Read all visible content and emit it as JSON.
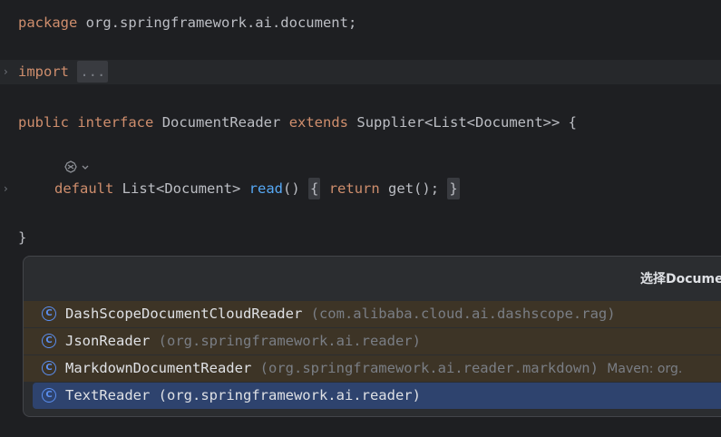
{
  "editor": {
    "package_line": {
      "keyword": "package",
      "rest": " org.springframework.ai.document;"
    },
    "import_line": {
      "keyword": "import",
      "folded": "..."
    },
    "interface_line": {
      "kw_public": "public",
      "kw_interface": "interface",
      "name": "DocumentReader",
      "kw_extends": "extends",
      "supertype": "Supplier<List<Document>> {"
    },
    "default_line": {
      "kw_default": "default",
      "type": "List<Document>",
      "method": "read",
      "parens": "()",
      "open_brace": "{",
      "kw_return": "return",
      "body": "get();",
      "close_brace": "}"
    },
    "closing_brace": "}",
    "fold_arrow": "›"
  },
  "popup": {
    "title": "选择Docume",
    "items": [
      {
        "name": "DashScopeDocumentCloudReader",
        "pkg": "(com.alibaba.cloud.ai.dashscope.rag)",
        "maven": "",
        "selected": false
      },
      {
        "name": "JsonReader",
        "pkg": "(org.springframework.ai.reader)",
        "maven": "",
        "selected": false
      },
      {
        "name": "MarkdownDocumentReader",
        "pkg": "(org.springframework.ai.reader.markdown)",
        "maven": "Maven: org.",
        "selected": false
      },
      {
        "name": "TextReader",
        "pkg": "(org.springframework.ai.reader)",
        "maven": "",
        "selected": true
      }
    ],
    "class_icon_letter": "C"
  },
  "colors": {
    "background": "#1e1f22",
    "keyword": "#cf8e6d",
    "function": "#56a8f5",
    "selection": "#2e436e",
    "item_highlight": "#3d3426"
  }
}
